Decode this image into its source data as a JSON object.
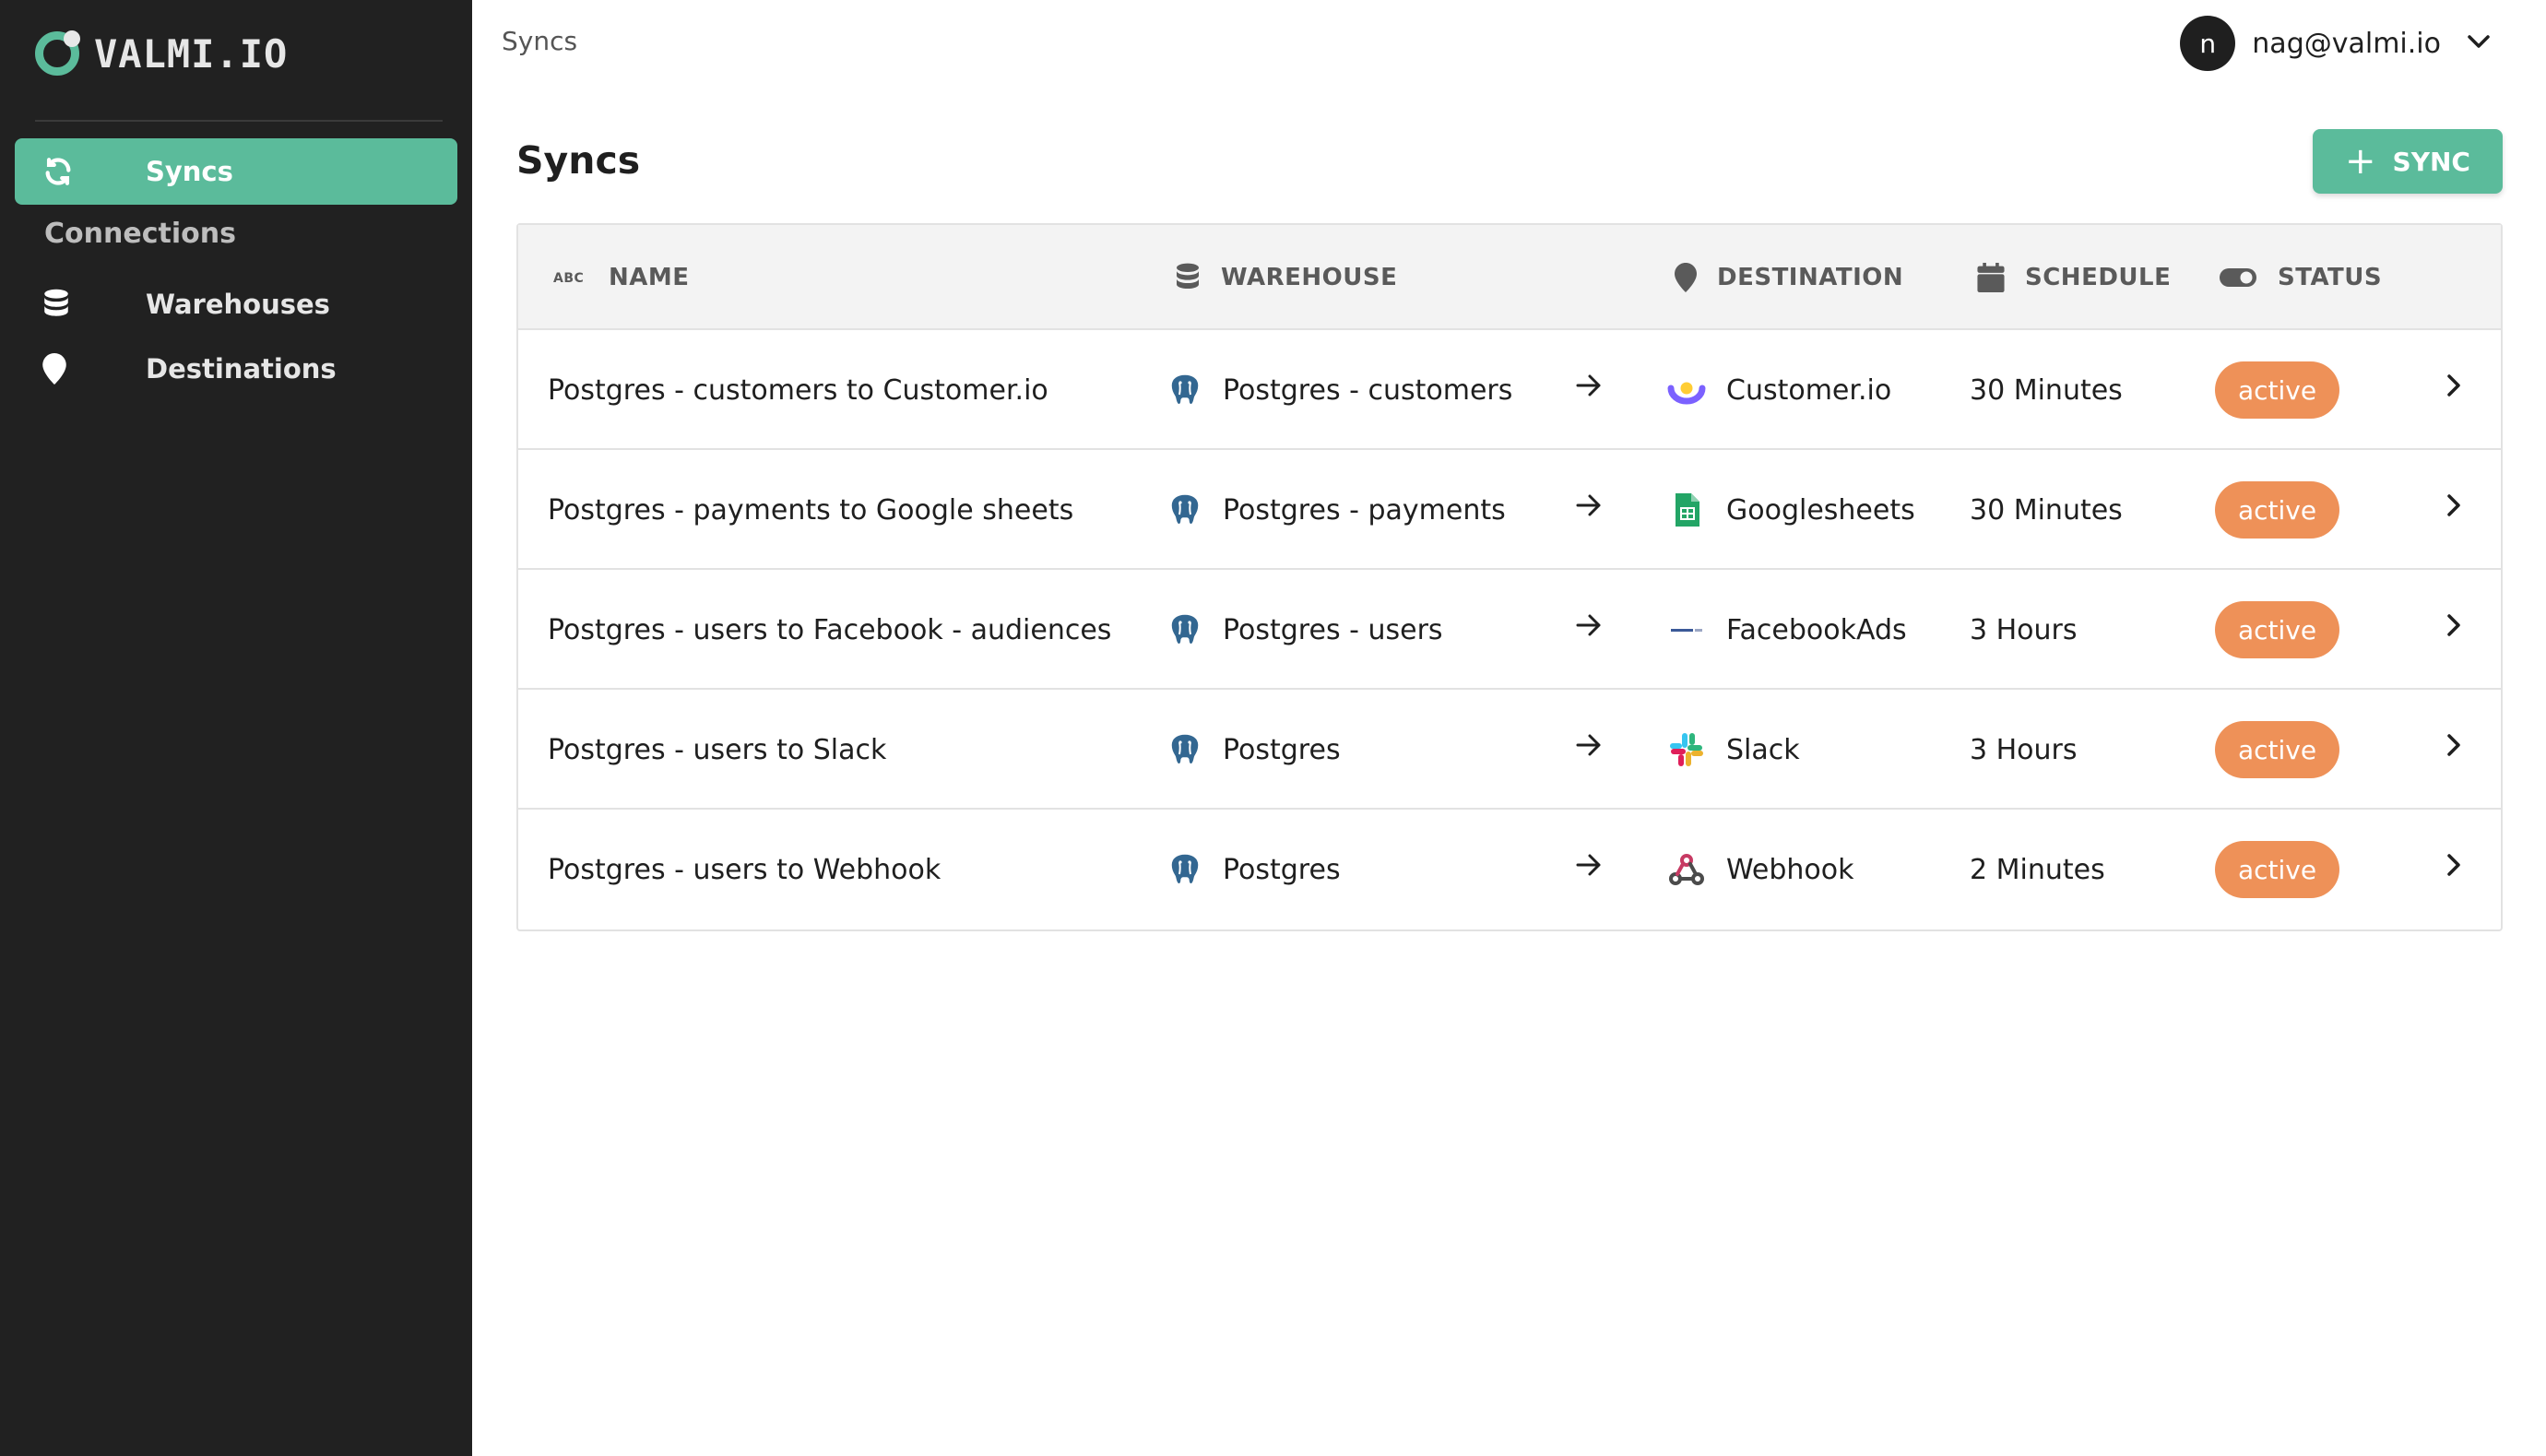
{
  "app": {
    "logo_text": "VALMI.IO"
  },
  "sidebar": {
    "items": [
      {
        "label": "Syncs",
        "icon": "refresh-icon",
        "active": true
      },
      {
        "label": "Warehouses",
        "icon": "database-icon",
        "active": false
      },
      {
        "label": "Destinations",
        "icon": "map-pin-icon",
        "active": false
      }
    ],
    "section_label": "Connections"
  },
  "header": {
    "breadcrumb": "Syncs",
    "user": {
      "avatar_initial": "n",
      "email": "nag@valmi.io"
    }
  },
  "main": {
    "title": "Syncs",
    "add_button_label": "SYNC"
  },
  "table": {
    "columns": [
      {
        "label": "NAME",
        "icon": "abc-icon"
      },
      {
        "label": "WAREHOUSE",
        "icon": "database-icon"
      },
      {
        "label": "DESTINATION",
        "icon": "map-pin-icon"
      },
      {
        "label": "SCHEDULE",
        "icon": "calendar-icon"
      },
      {
        "label": "STATUS",
        "icon": "toggle-icon"
      }
    ],
    "rows": [
      {
        "name": "Postgres - customers to Customer.io",
        "warehouse": "Postgres - customers",
        "destination": "Customer.io",
        "destination_icon": "customerio-icon",
        "schedule": "30 Minutes",
        "status": "active"
      },
      {
        "name": "Postgres - payments to Google sheets",
        "warehouse": "Postgres - payments",
        "destination": "Googlesheets",
        "destination_icon": "googlesheets-icon",
        "schedule": "30 Minutes",
        "status": "active"
      },
      {
        "name": "Postgres - users to Facebook - audiences",
        "warehouse": "Postgres - users",
        "destination": "FacebookAds",
        "destination_icon": "facebookads-icon",
        "schedule": "3 Hours",
        "status": "active"
      },
      {
        "name": "Postgres - users to Slack",
        "warehouse": "Postgres",
        "destination": "Slack",
        "destination_icon": "slack-icon",
        "schedule": "3 Hours",
        "status": "active"
      },
      {
        "name": "Postgres - users to Webhook",
        "warehouse": "Postgres",
        "destination": "Webhook",
        "destination_icon": "webhook-icon",
        "schedule": "2 Minutes",
        "status": "active"
      }
    ]
  },
  "colors": {
    "sidebar_bg": "#212121",
    "accent": "#5bbb9b",
    "status_active": "#ee9158",
    "header_bg": "#f3f3f3"
  }
}
